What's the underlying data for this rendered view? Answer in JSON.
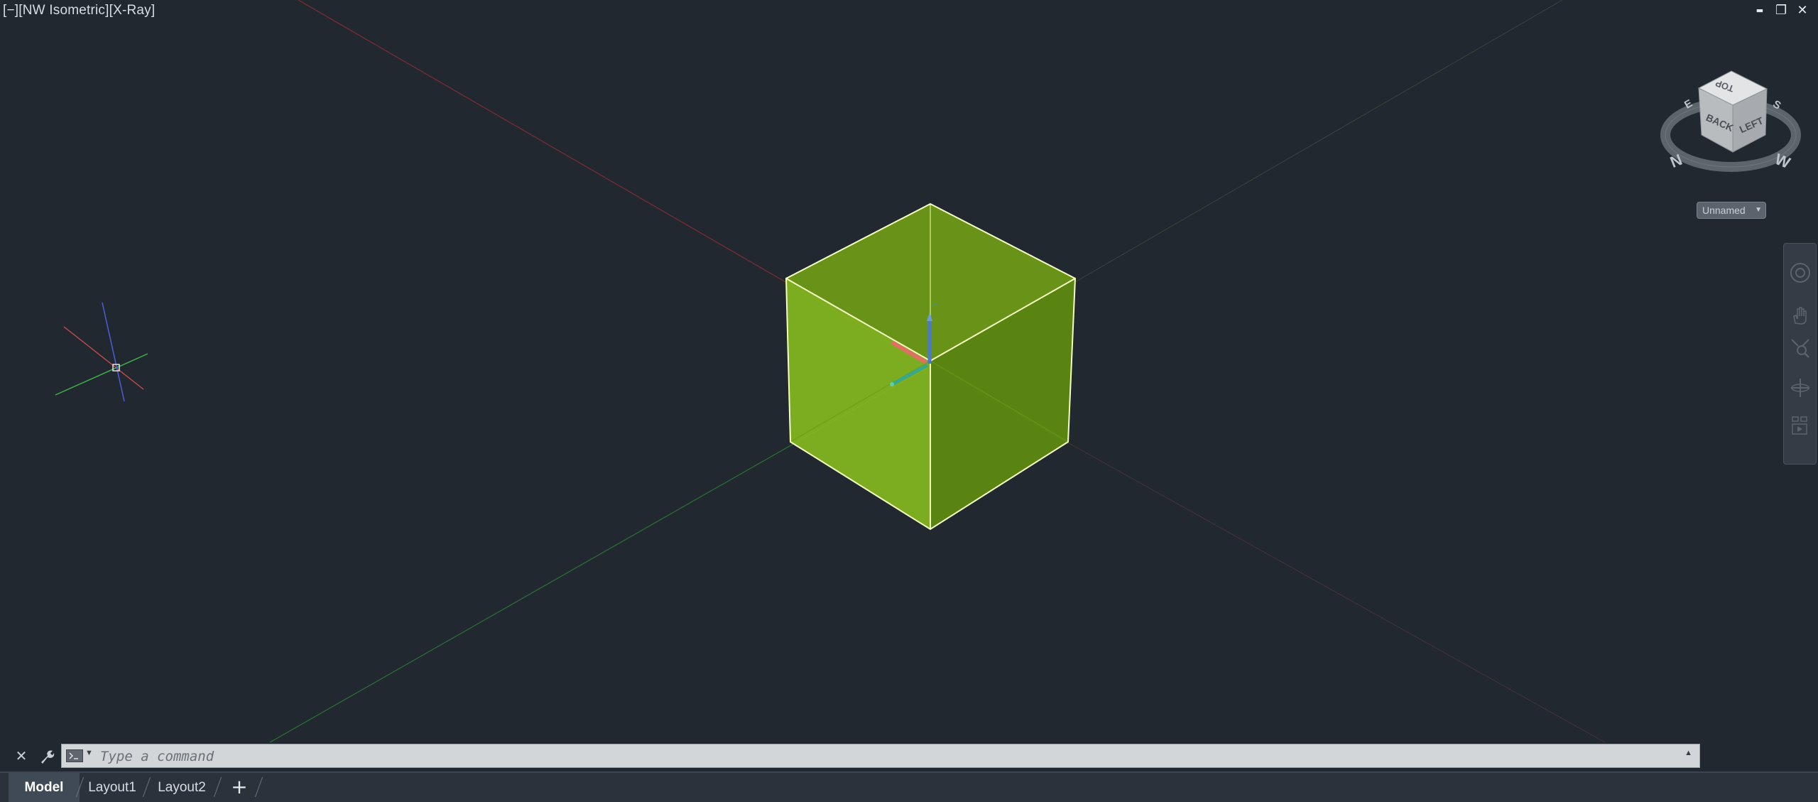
{
  "viewport": {
    "label": "[−][NW Isometric][X-Ray]",
    "view_name": "Unnamed"
  },
  "window_controls": {
    "minimize": "▬",
    "restore": "❐",
    "close": "✕"
  },
  "viewcube": {
    "faces": {
      "top": "TOP",
      "back": "BACK",
      "left": "LEFT"
    },
    "compass": {
      "north": "N",
      "west": "W",
      "south": "S",
      "east": "E"
    }
  },
  "command_line": {
    "close_icon": "✕",
    "customize_icon": "🔧",
    "placeholder": "Type a command"
  },
  "layout_tabs": {
    "tabs": [
      {
        "label": "Model",
        "active": true
      },
      {
        "label": "Layout1",
        "active": false
      },
      {
        "label": "Layout2",
        "active": false
      }
    ],
    "add_label": "+"
  },
  "colors": {
    "background": "#212830",
    "box_fill": "#7fb51a",
    "box_edges": "#f3ffb0",
    "axis_x": "#d03b3b",
    "axis_y": "#3ba83b",
    "axis_z": "#3b5ad8"
  }
}
